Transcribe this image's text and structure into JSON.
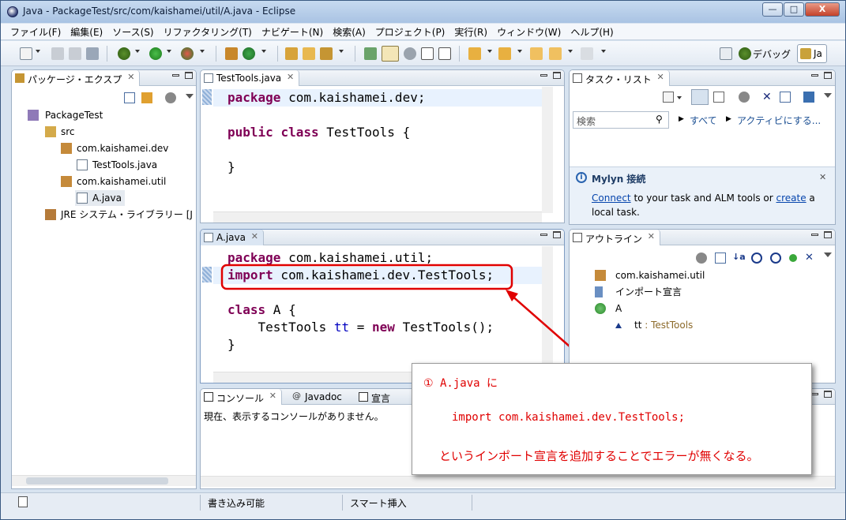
{
  "window": {
    "title": "Java - PackageTest/src/com/kaishamei/util/A.java - Eclipse",
    "controls": {
      "minimize": "—",
      "maximize": "□",
      "close": "X"
    }
  },
  "menubar": {
    "items": [
      "ファイル(F)",
      "編集(E)",
      "ソース(S)",
      "リファクタリング(T)",
      "ナビゲート(N)",
      "検索(A)",
      "プロジェクト(P)",
      "実行(R)",
      "ウィンドウ(W)",
      "ヘルプ(H)"
    ]
  },
  "toolbar": {
    "perspective_debug": "デバッグ",
    "perspective_java": "Ja"
  },
  "package_explorer": {
    "tab": "パッケージ・エクスプ",
    "tree": [
      {
        "label": "PackageTest",
        "icon": "project-icon"
      },
      {
        "label": "src",
        "icon": "source-folder-icon"
      },
      {
        "label": "com.kaishamei.dev",
        "icon": "package-icon"
      },
      {
        "label": "TestTools.java",
        "icon": "java-file-icon"
      },
      {
        "label": "com.kaishamei.util",
        "icon": "package-icon"
      },
      {
        "label": "A.java",
        "icon": "java-file-icon"
      },
      {
        "label": "JRE システム・ライブラリー [J",
        "icon": "library-icon"
      }
    ]
  },
  "editor_top": {
    "tab": "TestTools.java",
    "lines": {
      "l1_kw": "package",
      "l1_rest": " com.kaishamei.dev;",
      "l3_kw1": "public",
      "l3_kw2": "class",
      "l3_rest": " TestTools {",
      "l5": "}"
    }
  },
  "editor_bottom": {
    "tab": "A.java",
    "lines": {
      "l1_kw": "package",
      "l1_rest": " com.kaishamei.util;",
      "l2_kw": "import",
      "l2_rest": " com.kaishamei.dev.TestTools;",
      "l4_kw": "class",
      "l4_rest": " A {",
      "l5_type": "    TestTools ",
      "l5_field": "tt",
      "l5_eq": " = ",
      "l5_kw": "new",
      "l5_rest": " TestTools();",
      "l6": "}"
    }
  },
  "task_list": {
    "tab": "タスク・リスト",
    "search_placeholder": "検索",
    "filter_all": "すべて",
    "filter_active": "アクティビにする...",
    "mylyn_title": "Mylyn 接続",
    "mylyn_connect": "Connect",
    "mylyn_text1": " to your task and ALM tools or ",
    "mylyn_create": "create",
    "mylyn_text2": " a",
    "mylyn_text3": "local task."
  },
  "outline": {
    "tab": "アウトライン",
    "items": [
      {
        "label": "com.kaishamei.util",
        "icon": "package-icon"
      },
      {
        "label": "インポート宣言",
        "icon": "imports-icon"
      },
      {
        "label": "A",
        "icon": "class-icon"
      },
      {
        "label": "tt",
        "type": " : TestTools",
        "icon": "field-icon"
      }
    ]
  },
  "console": {
    "tabs": [
      "コンソール",
      "Javadoc",
      "宣言"
    ],
    "message": "現在、表示するコンソールがありません。"
  },
  "statusbar": {
    "writable": "書き込み可能",
    "insert_mode": "スマート挿入"
  },
  "callout": {
    "line1": "① A.java に",
    "line2": "import com.kaishamei.dev.TestTools;",
    "line3": "というインポート宣言を追加することでエラーが無くなる。"
  },
  "colors": {
    "keyword": "#7f0055",
    "field": "#0000c0",
    "annotation_red": "#e00000",
    "link": "#0645ad"
  }
}
